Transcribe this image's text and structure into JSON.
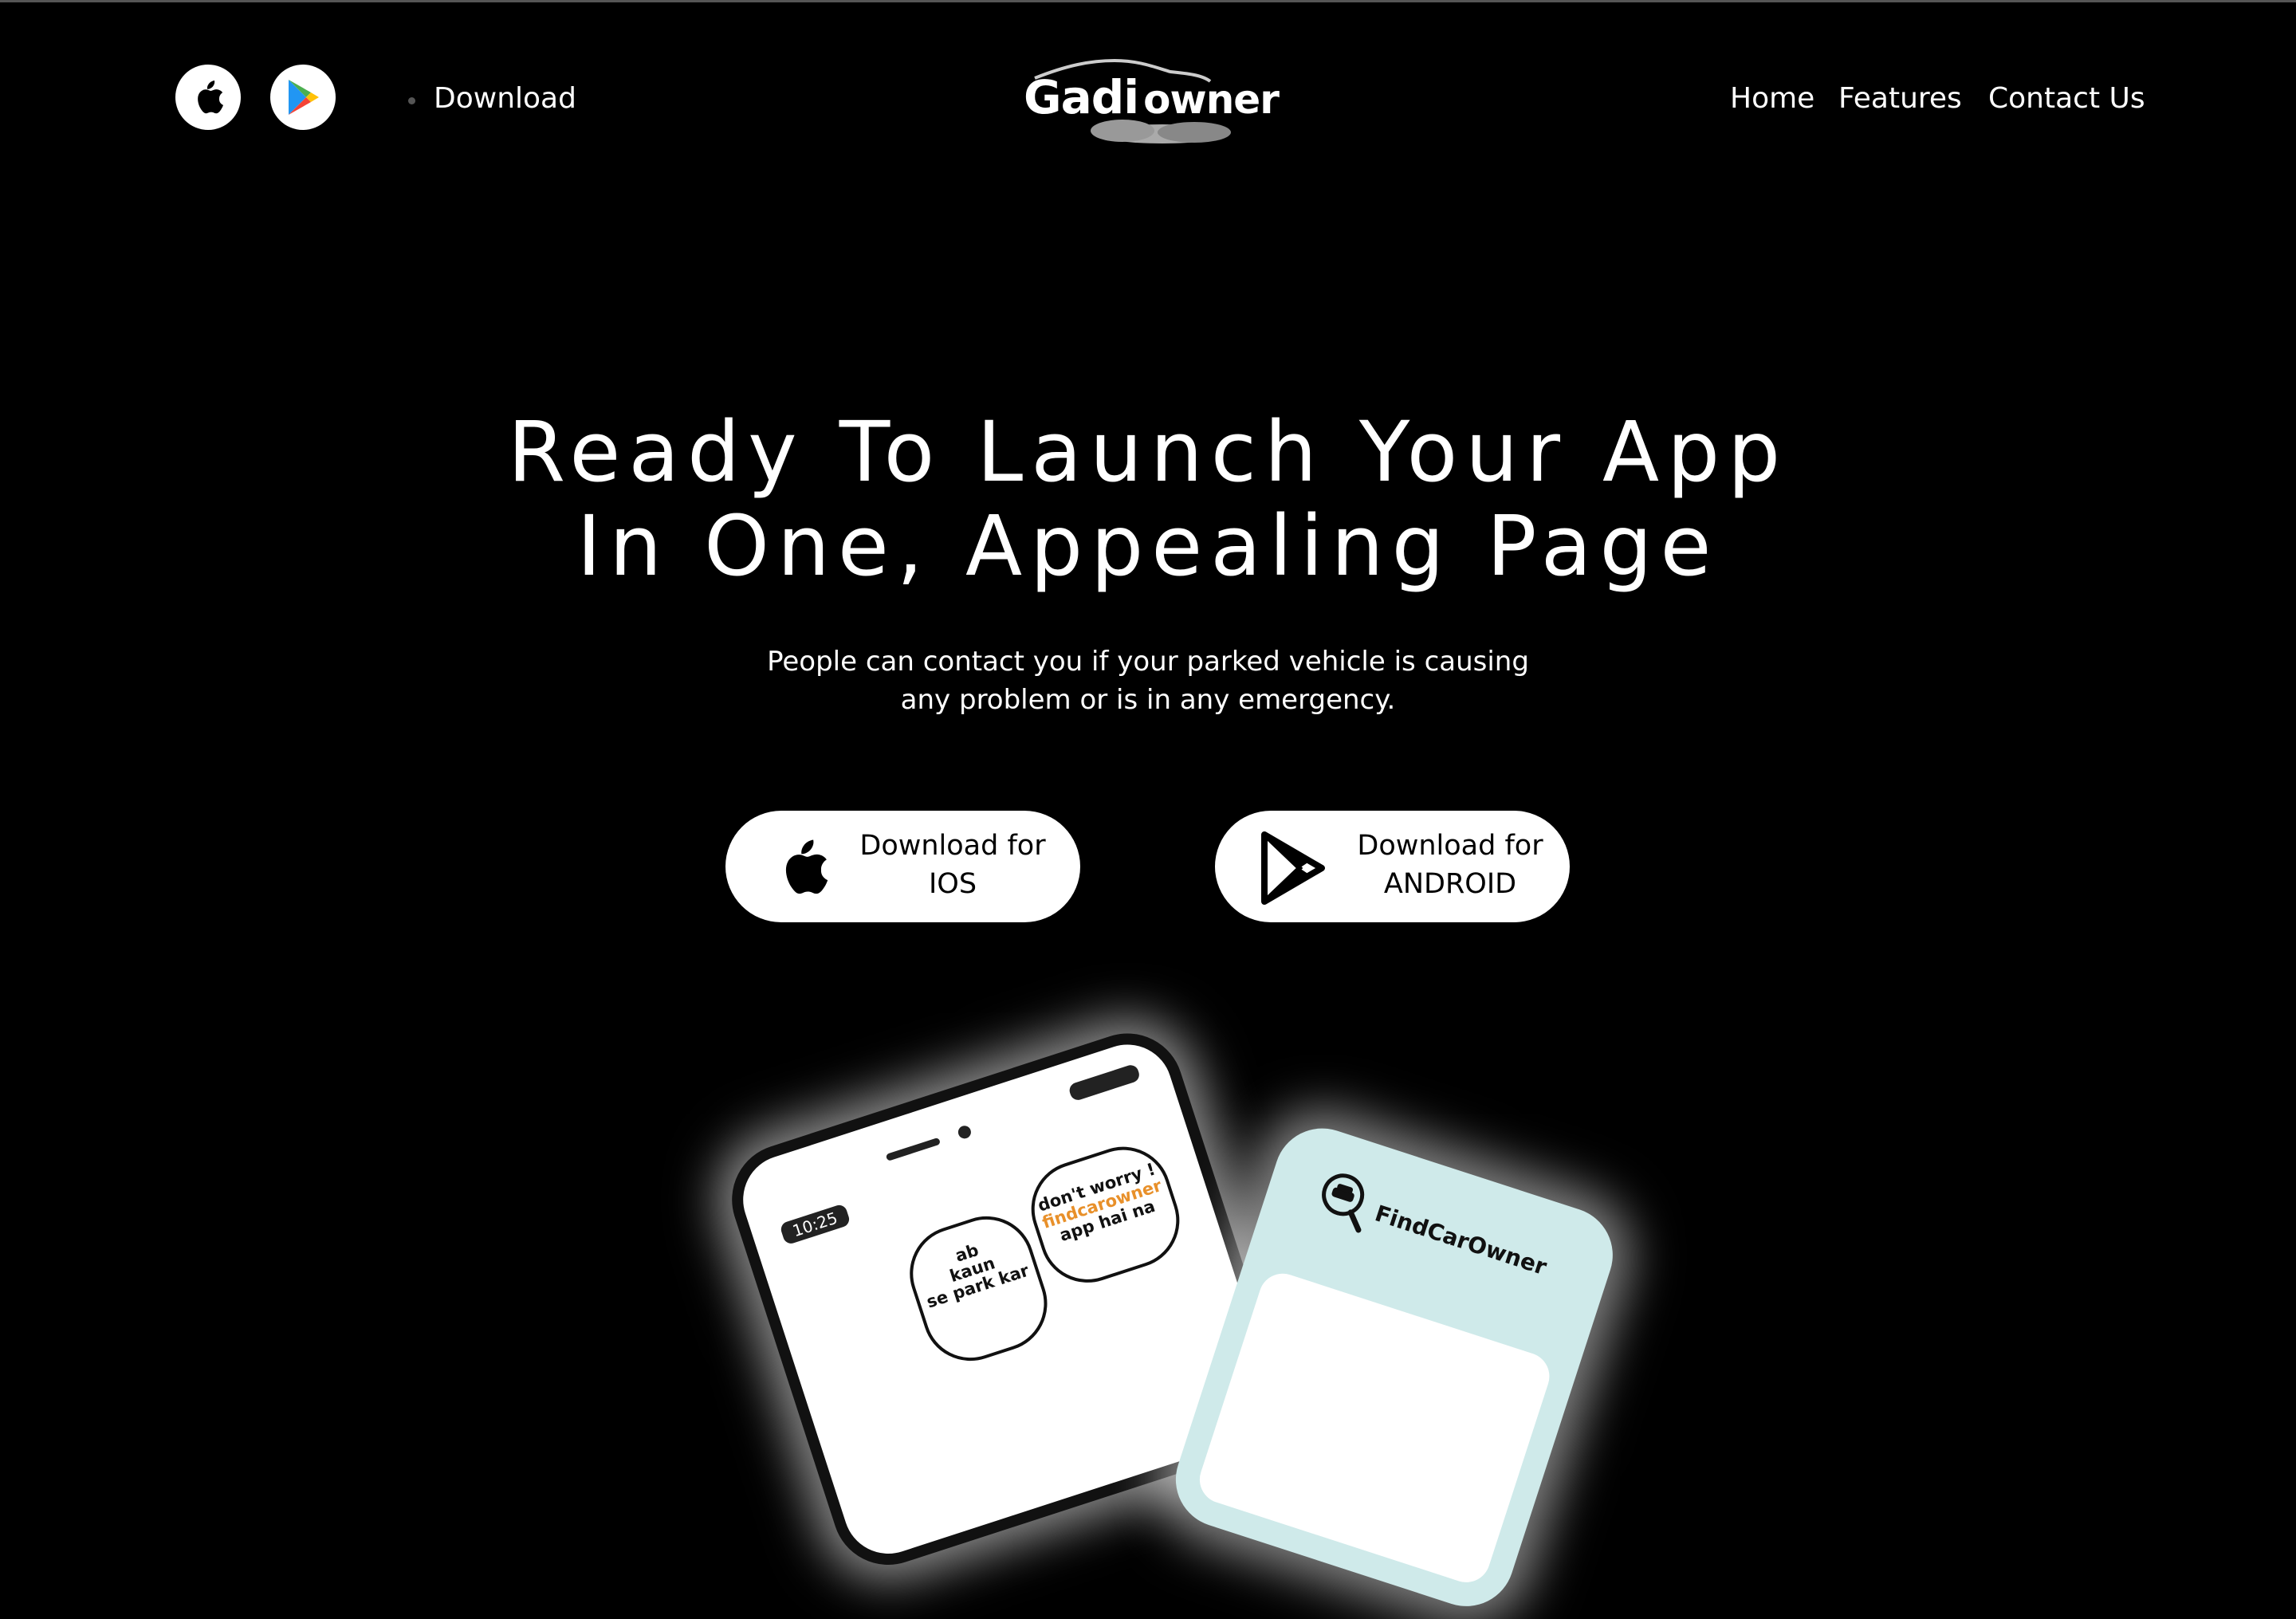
{
  "header": {
    "download_label": "Download",
    "logo": {
      "text_main": "Gadi",
      "text_suffix": "owner"
    },
    "nav": {
      "home": "Home",
      "features": "Features",
      "contact": "Contact Us"
    },
    "store_icons": [
      "apple-icon",
      "google-play-icon"
    ]
  },
  "hero": {
    "title_line1": "Ready To Launch Your App",
    "title_line2": "In One, Appealing Page",
    "subtitle_line1": "People can contact you if your parked vehicle is causing",
    "subtitle_line2": "any problem or is in any emergency."
  },
  "cta": {
    "ios": {
      "line1": "Download for",
      "line2": "IOS",
      "icon": "apple-icon"
    },
    "android": {
      "line1": "Download for",
      "line2": "ANDROID",
      "icon": "google-play-icon"
    }
  },
  "phones": {
    "left": {
      "time": "10:25",
      "bubble1": [
        "ab",
        "kaun",
        "se park kar"
      ],
      "bubble2": [
        "don't worry !",
        "findcarowner",
        "app hai na"
      ]
    },
    "right": {
      "brand": "FindCarOwner"
    }
  },
  "colors": {
    "background": "#000000",
    "foreground": "#ffffff",
    "phone_screen": "#cfeaea",
    "accent_orange": "#e8902a"
  }
}
